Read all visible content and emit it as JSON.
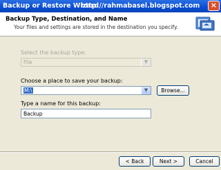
{
  "window": {
    "title": "Backup or Restore Wizard",
    "watermark": "http://rahmabasel.blogspot.com",
    "close_glyph": "×"
  },
  "header": {
    "title": "Backup Type, Destination, and Name",
    "subtitle": "Your files and settings are stored in the destination you specify.",
    "icon": "backup-wizard-icon"
  },
  "form": {
    "backup_type_label": "Select the backup type:",
    "backup_type_value": "File",
    "destination_label": "Choose a place to save your backup:",
    "destination_value": "M:\\",
    "browse_label": "Browse...",
    "name_label": "Type a name for this backup:",
    "name_value": "Backup"
  },
  "footer": {
    "back_label": "< Back",
    "next_label": "Next >",
    "cancel_label": "Cancel"
  },
  "colors": {
    "titlebar": "#0a4fd6",
    "selection": "#316ac5",
    "dialog_bg": "#ece9d8"
  }
}
